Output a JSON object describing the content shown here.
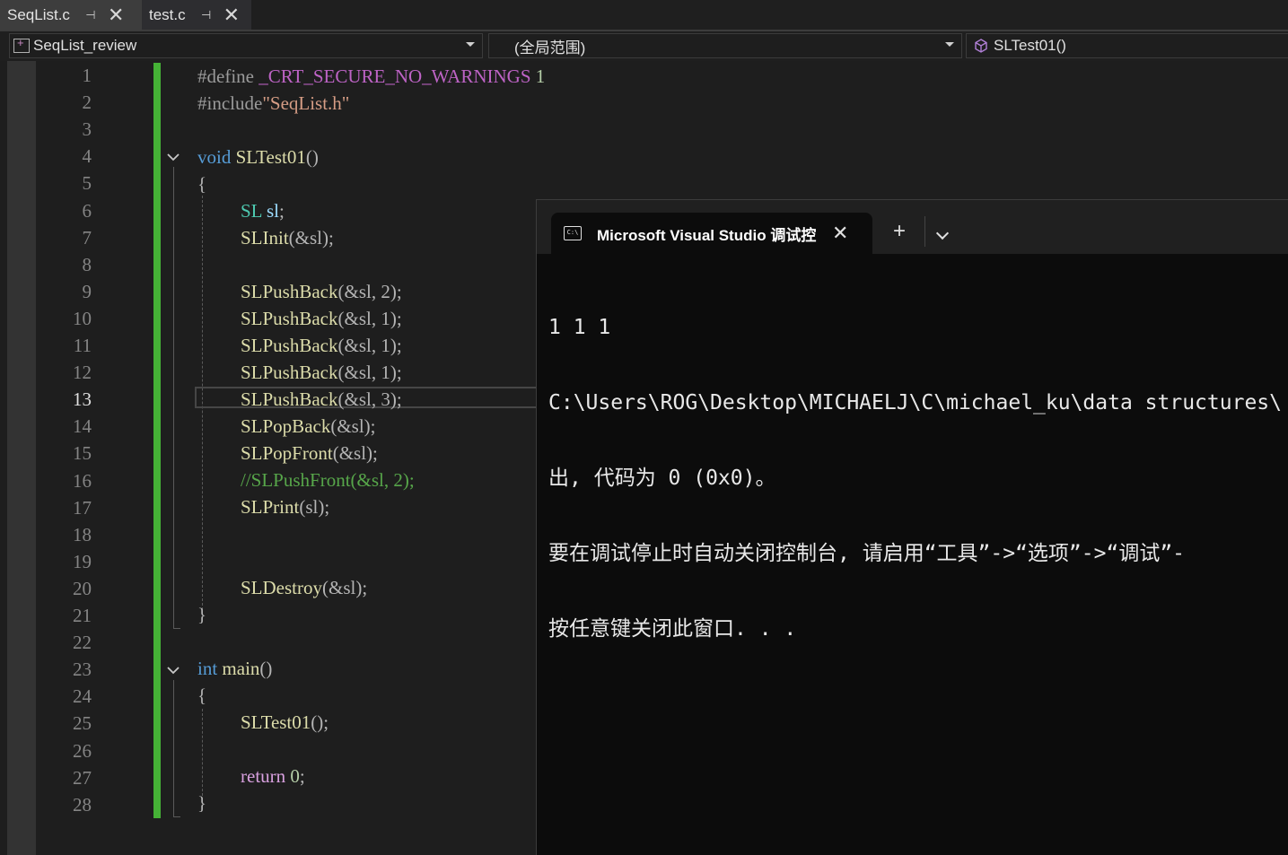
{
  "tabs": [
    {
      "name": "SeqList.c",
      "active": true
    },
    {
      "name": "test.c",
      "active": false
    }
  ],
  "navbar": {
    "project": "SeqList_review",
    "scope": "(全局范围)",
    "member": "SLTest01()"
  },
  "editor": {
    "current_line": 13,
    "line_numbers": [
      "1",
      "2",
      "3",
      "4",
      "5",
      "6",
      "7",
      "8",
      "9",
      "10",
      "11",
      "12",
      "13",
      "14",
      "15",
      "16",
      "17",
      "18",
      "19",
      "20",
      "21",
      "22",
      "23",
      "24",
      "25",
      "26",
      "27",
      "28"
    ],
    "code": {
      "l1_define": "#define",
      "l1_macro": "_CRT_SECURE_NO_WARNINGS",
      "l1_val": "1",
      "l2_include": "#include",
      "l2_file": "\"SeqList.h\"",
      "l4_kw": "void",
      "l4_fn": "SLTest01",
      "l4_paren": "()",
      "brace_open": "{",
      "brace_close": "}",
      "l6_type": "SL",
      "l6_var": "sl",
      "l7_fn": "SLInit",
      "l7_args": "(&sl);",
      "pushback_fn": "SLPushBack",
      "l9_args": "(&sl, 2);",
      "l10_args": "(&sl, 1);",
      "l11_args": "(&sl, 1);",
      "l12_args": "(&sl, 1);",
      "l13_args": "(&sl, 3);",
      "l14_fn": "SLPopBack",
      "l14_args": "(&sl);",
      "l15_fn": "SLPopFront",
      "l15_args": "(&sl);",
      "l16_comment": "//SLPushFront(&sl, 2);",
      "l17_fn": "SLPrint",
      "l17_args": "(sl);",
      "l20_fn": "SLDestroy",
      "l20_args": "(&sl);",
      "l23_kw": "int",
      "l23_fn": "main",
      "l23_paren": "()",
      "l25_fn": "SLTest01",
      "l25_args": "();",
      "l27_kw": "return",
      "l27_val": "0",
      "l27_end": ";"
    }
  },
  "terminal": {
    "tab_title": "Microsoft Visual Studio 调试控",
    "new_tab": "+",
    "output": [
      "1 1 1",
      "C:\\Users\\ROG\\Desktop\\MICHAELJ\\C\\michael_ku\\data structures\\",
      "出, 代码为 0 (0x0)。",
      "要在调试停止时自动关闭控制台, 请启用“工具”->“选项”->“调试”-",
      "按任意键关闭此窗口. . ."
    ]
  },
  "colors": {
    "keyword": "#569cd6",
    "function": "#dcdcaa",
    "type": "#4ec9b0",
    "comment": "#57a64a",
    "changed_lines_bar": "#45b236",
    "terminal_bg": "#0c0c0c"
  }
}
